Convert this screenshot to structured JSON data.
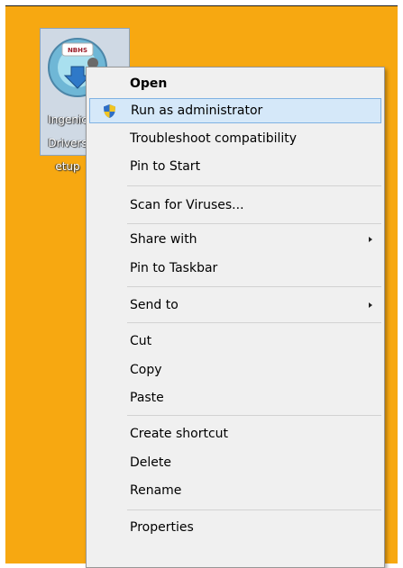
{
  "desktop": {
    "background_color": "#f7a811",
    "icon": {
      "name": "Ingenico Drivers Setup",
      "label_lines": [
        "Ingenic",
        "Drivers",
        "etup"
      ],
      "badge_text": "NBHS",
      "icon_name": "installer-disc-icon"
    }
  },
  "context_menu": {
    "items": [
      {
        "label": "Open",
        "bold": true
      },
      {
        "label": "Run as administrator",
        "icon": "uac-shield-icon",
        "highlighted": true
      },
      {
        "label": "Troubleshoot compatibility"
      },
      {
        "label": "Pin to Start"
      },
      {
        "label": "Scan for Viruses..."
      },
      {
        "label": "Share with",
        "submenu": true
      },
      {
        "label": "Pin to Taskbar"
      },
      {
        "label": "Send to",
        "submenu": true
      },
      {
        "label": "Cut"
      },
      {
        "label": "Copy"
      },
      {
        "label": "Paste"
      },
      {
        "label": "Create shortcut"
      },
      {
        "label": "Delete"
      },
      {
        "label": "Rename"
      },
      {
        "label": "Properties"
      }
    ]
  }
}
